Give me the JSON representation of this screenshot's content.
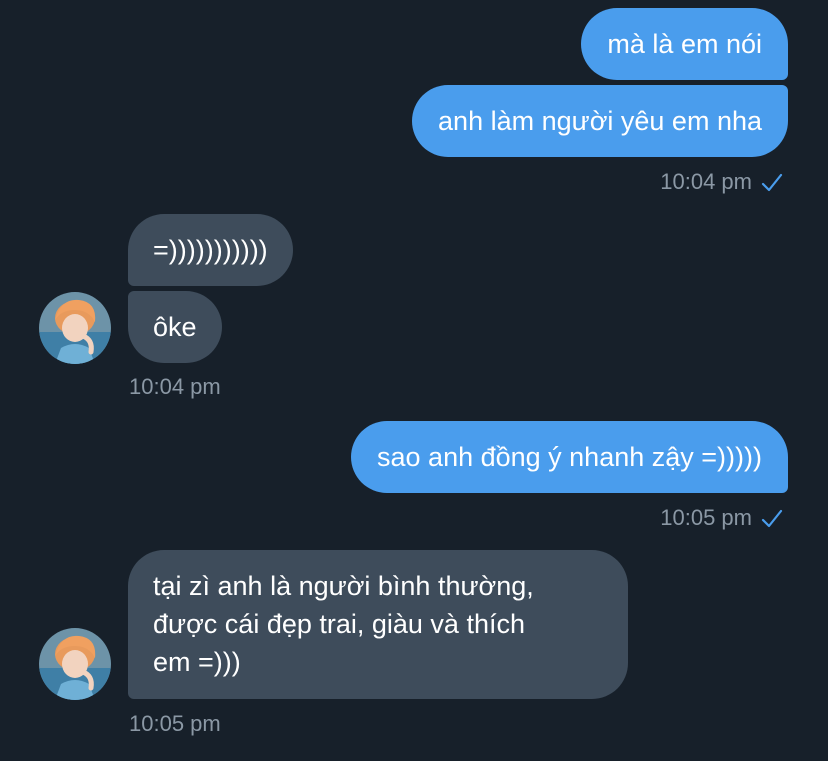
{
  "colors": {
    "background": "#17202a",
    "outgoing_bubble": "#4a9ded",
    "incoming_bubble": "#3e4c5b",
    "meta_text": "#8b98a5",
    "read_check": "#4a9ded"
  },
  "messages": [
    {
      "direction": "outgoing",
      "text": "mà là em nói"
    },
    {
      "direction": "outgoing",
      "text": "anh làm người yêu em nha",
      "time": "10:04 pm",
      "status": "read-check-icon"
    },
    {
      "direction": "incoming",
      "text": "=)))))))))))"
    },
    {
      "direction": "incoming",
      "text": "ôke",
      "time": "10:04 pm",
      "avatar": "avatar-icon"
    },
    {
      "direction": "outgoing",
      "text": "sao anh đồng ý nhanh zậy =)))))",
      "time": "10:05 pm",
      "status": "read-check-icon"
    },
    {
      "direction": "incoming",
      "lines": [
        "tại zì anh là người bình thường,",
        "được cái đẹp trai, giàu và thích",
        "em =)))"
      ],
      "time": "10:05 pm",
      "avatar": "avatar-icon"
    }
  ]
}
